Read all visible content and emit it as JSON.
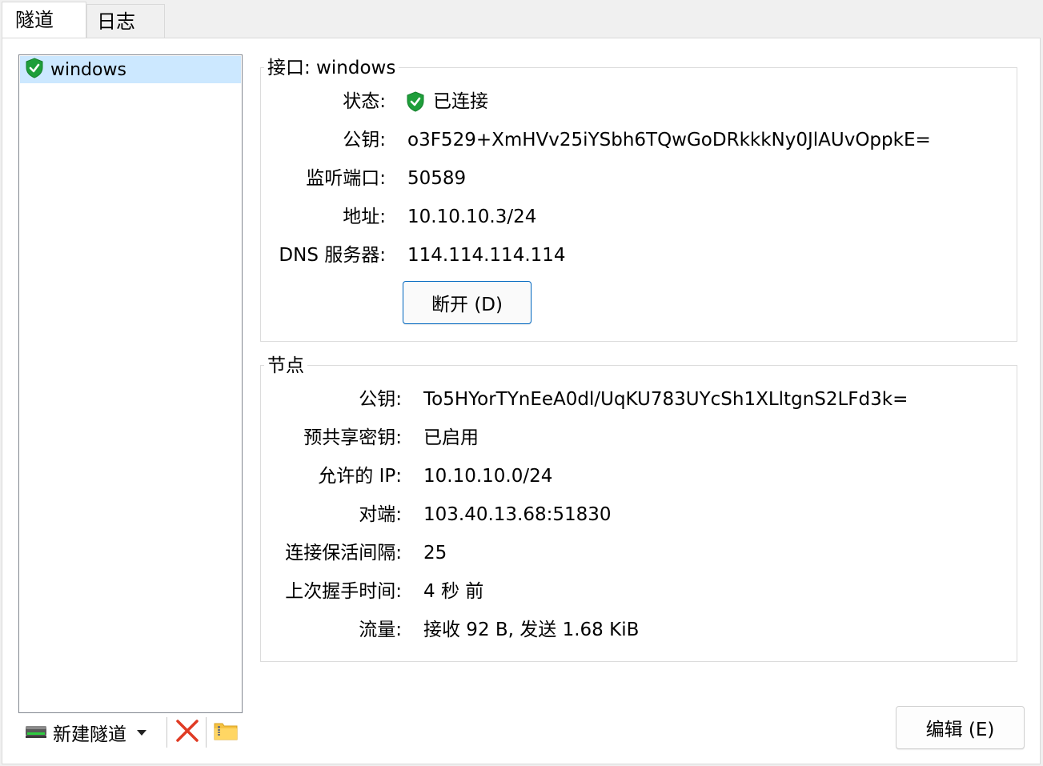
{
  "tabs": [
    {
      "label": "隧道",
      "active": true
    },
    {
      "label": "日志",
      "active": false
    }
  ],
  "tunnels": [
    {
      "name": "windows",
      "status_icon": "shield-check-icon",
      "selected": true
    }
  ],
  "toolbar": {
    "new_tunnel_label": "新建隧道",
    "new_tunnel_icon": "network-drive-icon",
    "dropdown_icon": "caret-down-icon",
    "delete_icon": "red-x-icon",
    "export_icon": "zip-folder-icon"
  },
  "interface": {
    "title": "接口: windows",
    "status_label": "状态:",
    "status_value": "已连接",
    "pubkey_label": "公钥:",
    "pubkey_value": "o3F529+XmHVv25iYSbh6TQwGoDRkkkNy0JlAUvOppkE=",
    "port_label": "监听端口:",
    "port_value": "50589",
    "address_label": "地址:",
    "address_value": "10.10.10.3/24",
    "dns_label": "DNS 服务器:",
    "dns_value": "114.114.114.114",
    "disconnect_button": "断开 (D)"
  },
  "peer": {
    "title": "节点",
    "pubkey_label": "公钥:",
    "pubkey_value": "To5HYorTYnEeA0dl/UqKU783UYcSh1XLltgnS2LFd3k=",
    "psk_label": "预共享密钥:",
    "psk_value": "已启用",
    "allowed_ips_label": "允许的 IP:",
    "allowed_ips_value": "10.10.10.0/24",
    "endpoint_label": "对端:",
    "endpoint_value": "103.40.13.68:51830",
    "keepalive_label": "连接保活间隔:",
    "keepalive_value": "25",
    "handshake_label": "上次握手时间:",
    "handshake_value": "4 秒 前",
    "transfer_label": "流量:",
    "transfer_value": "接收 92 B, 发送 1.68 KiB"
  },
  "edit_button": "编辑 (E)",
  "colors": {
    "selection": "#cce8ff",
    "shield_green": "#1e9e3a",
    "delete_red": "#e03b24",
    "focus_blue": "#0067c0"
  }
}
